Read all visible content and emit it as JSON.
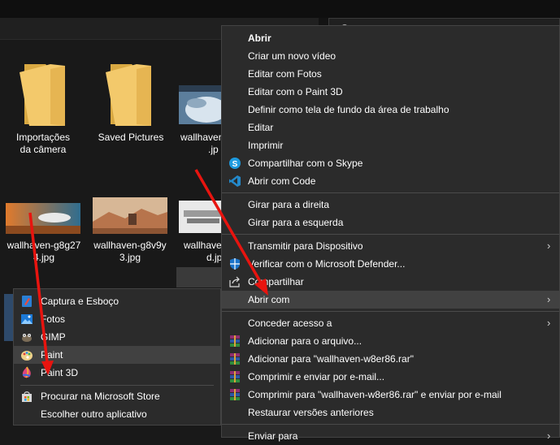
{
  "explorer": {
    "items_row1": [
      {
        "label_line1": "Importações",
        "label_line2": "da câmera"
      },
      {
        "label_line1": "Saved Pictures",
        "label_line2": ""
      },
      {
        "label_line1": "wallhaven-",
        "label_line2": ".jp"
      }
    ],
    "items_row2": [
      {
        "label_line1": "wallhaven-g8g27",
        "label_line2": "4.jpg"
      },
      {
        "label_line1": "wallhaven-g8v9y",
        "label_line2": "3.jpg"
      },
      {
        "label_line1": "wallhave",
        "label_line2": "d.jpg"
      }
    ]
  },
  "context_menu": {
    "items": [
      {
        "label": "Abrir"
      },
      {
        "label": "Criar um novo vídeo"
      },
      {
        "label": "Editar com Fotos"
      },
      {
        "label": "Editar com o Paint 3D"
      },
      {
        "label": "Definir como tela de fundo da área de trabalho"
      },
      {
        "label": "Editar"
      },
      {
        "label": "Imprimir"
      },
      {
        "label": "Compartilhar com o Skype",
        "icon": "skype-icon"
      },
      {
        "label": "Abrir com Code",
        "icon": "vscode-icon"
      },
      {
        "label": "Girar para a direita"
      },
      {
        "label": "Girar para a esquerda"
      },
      {
        "label": "Transmitir para Dispositivo"
      },
      {
        "label": "Verificar com o Microsoft Defender...",
        "icon": "defender-shield-icon"
      },
      {
        "label": "Compartilhar",
        "icon": "share-icon"
      },
      {
        "label": "Abrir com"
      },
      {
        "label": "Conceder acesso a"
      },
      {
        "label": "Adicionar para o arquivo...",
        "icon": "winrar-icon"
      },
      {
        "label": "Adicionar para \"wallhaven-w8er86.rar\"",
        "icon": "winrar-icon"
      },
      {
        "label": "Comprimir e enviar por e-mail...",
        "icon": "winrar-icon"
      },
      {
        "label": "Comprimir para \"wallhaven-w8er86.rar\" e enviar por e-mail",
        "icon": "winrar-icon"
      },
      {
        "label": "Restaurar versões anteriores"
      },
      {
        "label": "Enviar para"
      }
    ],
    "chevron": "›"
  },
  "open_with_submenu": {
    "items": [
      {
        "label": "Captura e Esboço",
        "icon": "snip-sketch-icon"
      },
      {
        "label": "Fotos",
        "icon": "photos-icon"
      },
      {
        "label": "GIMP",
        "icon": "gimp-icon"
      },
      {
        "label": "Paint",
        "icon": "paint-icon"
      },
      {
        "label": "Paint 3D",
        "icon": "paint3d-icon"
      },
      {
        "label": "Procurar na Microsoft Store",
        "icon": "store-icon"
      },
      {
        "label": "Escolher outro aplicativo"
      }
    ]
  },
  "colors": {
    "menu_bg": "#2b2b2b",
    "menu_highlight": "#414141",
    "annotation_arrow": "#e8140f",
    "folder_yellow": "#f3c96b"
  }
}
